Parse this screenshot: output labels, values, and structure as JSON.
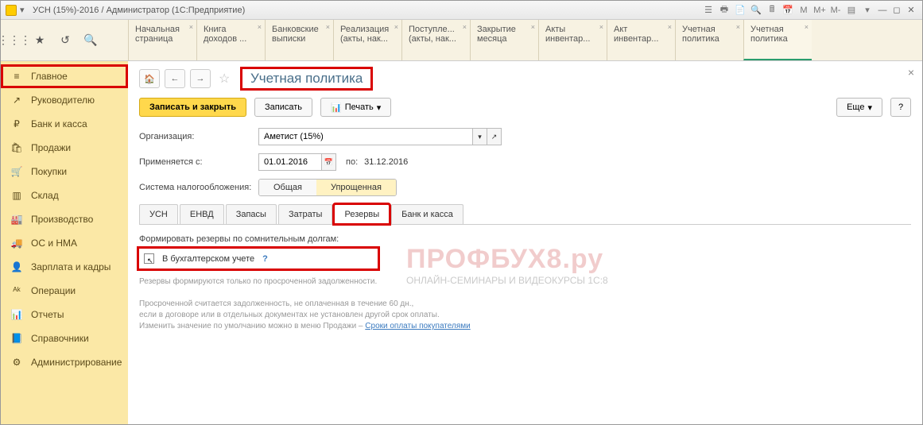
{
  "titlebar": {
    "title": "УСН (15%)-2016 / Администратор  (1С:Предприятие)"
  },
  "tabs": [
    {
      "t1": "Начальная",
      "t2": "страница"
    },
    {
      "t1": "Книга",
      "t2": "доходов ..."
    },
    {
      "t1": "Банковские",
      "t2": "выписки"
    },
    {
      "t1": "Реализация",
      "t2": "(акты, нак..."
    },
    {
      "t1": "Поступле...",
      "t2": "(акты, нак..."
    },
    {
      "t1": "Закрытие",
      "t2": "месяца"
    },
    {
      "t1": "Акты",
      "t2": "инвентар..."
    },
    {
      "t1": "Акт",
      "t2": "инвентар..."
    },
    {
      "t1": "Учетная",
      "t2": "политика"
    },
    {
      "t1": "Учетная",
      "t2": "политика"
    }
  ],
  "sidebar": [
    {
      "icon": "≡",
      "label": "Главное",
      "hl": true
    },
    {
      "icon": "↗",
      "label": "Руководителю"
    },
    {
      "icon": "₽",
      "label": "Банк и касса"
    },
    {
      "icon": "🛍",
      "label": "Продажи"
    },
    {
      "icon": "🛒",
      "label": "Покупки"
    },
    {
      "icon": "▥",
      "label": "Склад"
    },
    {
      "icon": "🏭",
      "label": "Производство"
    },
    {
      "icon": "🚚",
      "label": "ОС и НМА"
    },
    {
      "icon": "👤",
      "label": "Зарплата и кадры"
    },
    {
      "icon": "ᴬᵏ",
      "label": "Операции"
    },
    {
      "icon": "📊",
      "label": "Отчеты"
    },
    {
      "icon": "📘",
      "label": "Справочники"
    },
    {
      "icon": "⚙",
      "label": "Администрирование"
    }
  ],
  "page": {
    "title": "Учетная политика",
    "save_close": "Записать и закрыть",
    "save": "Записать",
    "print": "Печать",
    "more": "Еще",
    "org_label": "Организация:",
    "org_value": "Аметист (15%)",
    "apply_from_label": "Применяется с:",
    "apply_from": "01.01.2016",
    "to_label": "по:",
    "to_value": "31.12.2016",
    "tax_system_label": "Система налогообложения:",
    "seg_general": "Общая",
    "seg_simple": "Упрощенная",
    "subtabs": [
      "УСН",
      "ЕНВД",
      "Запасы",
      "Затраты",
      "Резервы",
      "Банк и касса"
    ],
    "section_label": "Формировать резервы по сомнительным долгам:",
    "chk_label": "В бухгалтерском учете",
    "hint1": "Резервы формируются только по просроченной задолженности.",
    "hint2": "Просроченной считается задолженность, не оплаченная в течение 60 дн.,",
    "hint3": "если в договоре или в отдельных документах не установлен другой срок оплаты.",
    "hint4_a": "Изменить значение по умолчанию можно в меню Продажи – ",
    "hint4_link": "Сроки оплаты покупателями"
  },
  "watermark": {
    "main": "ПРОФБУХ8.ру",
    "sub": "ОНЛАЙН-СЕМИНАРЫ И ВИДЕОКУРСЫ 1С:8"
  }
}
